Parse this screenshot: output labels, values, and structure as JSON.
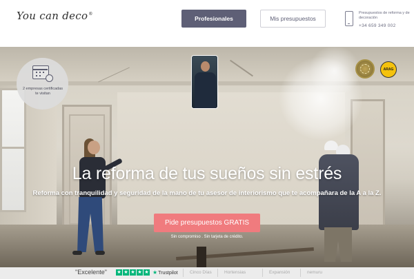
{
  "header": {
    "logo": "You can deco",
    "logo_mark": "®",
    "btn_professionals": "Profesionales",
    "btn_quotes": "Mis presupuestos",
    "contact_text": "Presupuestos de reforma y de decoración",
    "contact_phone": "+34 659 349 002"
  },
  "hero": {
    "title": "La reforma de tus sueños sin estrés",
    "subtitle": "Reforma con tranquilidad y seguridad de la mano de tu asesor de interiorismo que te acompañara de la A a la Z.",
    "cta_label": "Pide presupuestos GRATIS",
    "cta_note": "Sin compromiso . Sin tarjeta de crédito.",
    "badge_text": "2 empresas certificadas te visitan",
    "seal_arag": "ARAG"
  },
  "reviews": {
    "rating_word": "\"Excelente\"",
    "stars": [
      "★",
      "★",
      "★",
      "★",
      "★"
    ],
    "trustpilot": "Trustpilot",
    "press": [
      "Cinco Días",
      "Hortensias",
      "Expansión",
      "nemuru"
    ]
  },
  "icons": {
    "phone": "phone-icon",
    "calendar": "calendar-icon",
    "ribbon": "ribbon-icon"
  },
  "colors": {
    "primary": "#5e5f76",
    "cta": "#f07b7e",
    "trustpilot_green": "#00b67a"
  }
}
